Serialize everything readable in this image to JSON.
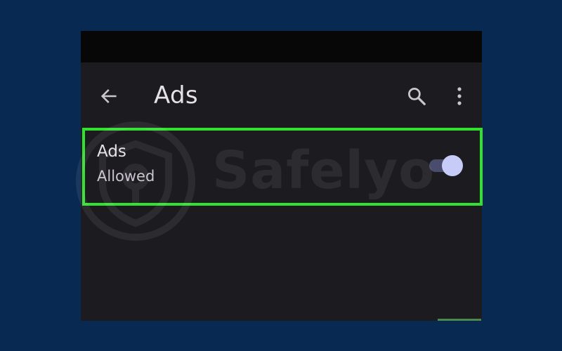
{
  "colors": {
    "backdrop": "#082a52",
    "phone_background": "#1c1b1f",
    "status_bar": "#070708",
    "text_primary": "#e6e1e5",
    "text_secondary": "#cac4d0",
    "icon": "#c9c6cc",
    "toggle_track": "#4a4c6e",
    "toggle_thumb": "#c6cbf7",
    "highlight": "#32e030",
    "watermark": "#ffffff",
    "accent_strip": "#6fd16a"
  },
  "app_bar": {
    "title": "Ads",
    "back_icon": "arrow-back-icon",
    "search_icon": "search-icon",
    "more_icon": "more-vert-icon"
  },
  "setting": {
    "title": "Ads",
    "subtitle": "Allowed",
    "toggle_on": true
  },
  "watermark": {
    "text": "Safelyo",
    "logo_icon": "shield-logo-icon"
  }
}
